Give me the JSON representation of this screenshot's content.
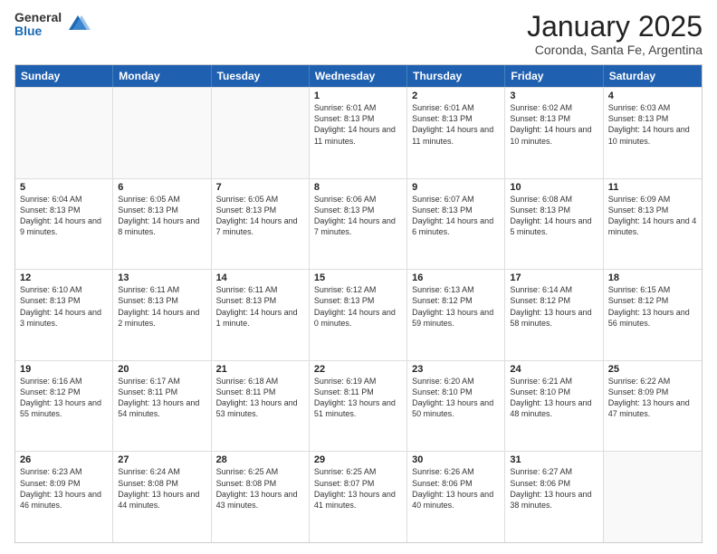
{
  "logo": {
    "general": "General",
    "blue": "Blue"
  },
  "title": "January 2025",
  "location": "Coronda, Santa Fe, Argentina",
  "days": [
    "Sunday",
    "Monday",
    "Tuesday",
    "Wednesday",
    "Thursday",
    "Friday",
    "Saturday"
  ],
  "rows": [
    [
      {
        "day": "",
        "text": ""
      },
      {
        "day": "",
        "text": ""
      },
      {
        "day": "",
        "text": ""
      },
      {
        "day": "1",
        "text": "Sunrise: 6:01 AM\nSunset: 8:13 PM\nDaylight: 14 hours and 11 minutes."
      },
      {
        "day": "2",
        "text": "Sunrise: 6:01 AM\nSunset: 8:13 PM\nDaylight: 14 hours and 11 minutes."
      },
      {
        "day": "3",
        "text": "Sunrise: 6:02 AM\nSunset: 8:13 PM\nDaylight: 14 hours and 10 minutes."
      },
      {
        "day": "4",
        "text": "Sunrise: 6:03 AM\nSunset: 8:13 PM\nDaylight: 14 hours and 10 minutes."
      }
    ],
    [
      {
        "day": "5",
        "text": "Sunrise: 6:04 AM\nSunset: 8:13 PM\nDaylight: 14 hours and 9 minutes."
      },
      {
        "day": "6",
        "text": "Sunrise: 6:05 AM\nSunset: 8:13 PM\nDaylight: 14 hours and 8 minutes."
      },
      {
        "day": "7",
        "text": "Sunrise: 6:05 AM\nSunset: 8:13 PM\nDaylight: 14 hours and 7 minutes."
      },
      {
        "day": "8",
        "text": "Sunrise: 6:06 AM\nSunset: 8:13 PM\nDaylight: 14 hours and 7 minutes."
      },
      {
        "day": "9",
        "text": "Sunrise: 6:07 AM\nSunset: 8:13 PM\nDaylight: 14 hours and 6 minutes."
      },
      {
        "day": "10",
        "text": "Sunrise: 6:08 AM\nSunset: 8:13 PM\nDaylight: 14 hours and 5 minutes."
      },
      {
        "day": "11",
        "text": "Sunrise: 6:09 AM\nSunset: 8:13 PM\nDaylight: 14 hours and 4 minutes."
      }
    ],
    [
      {
        "day": "12",
        "text": "Sunrise: 6:10 AM\nSunset: 8:13 PM\nDaylight: 14 hours and 3 minutes."
      },
      {
        "day": "13",
        "text": "Sunrise: 6:11 AM\nSunset: 8:13 PM\nDaylight: 14 hours and 2 minutes."
      },
      {
        "day": "14",
        "text": "Sunrise: 6:11 AM\nSunset: 8:13 PM\nDaylight: 14 hours and 1 minute."
      },
      {
        "day": "15",
        "text": "Sunrise: 6:12 AM\nSunset: 8:13 PM\nDaylight: 14 hours and 0 minutes."
      },
      {
        "day": "16",
        "text": "Sunrise: 6:13 AM\nSunset: 8:12 PM\nDaylight: 13 hours and 59 minutes."
      },
      {
        "day": "17",
        "text": "Sunrise: 6:14 AM\nSunset: 8:12 PM\nDaylight: 13 hours and 58 minutes."
      },
      {
        "day": "18",
        "text": "Sunrise: 6:15 AM\nSunset: 8:12 PM\nDaylight: 13 hours and 56 minutes."
      }
    ],
    [
      {
        "day": "19",
        "text": "Sunrise: 6:16 AM\nSunset: 8:12 PM\nDaylight: 13 hours and 55 minutes."
      },
      {
        "day": "20",
        "text": "Sunrise: 6:17 AM\nSunset: 8:11 PM\nDaylight: 13 hours and 54 minutes."
      },
      {
        "day": "21",
        "text": "Sunrise: 6:18 AM\nSunset: 8:11 PM\nDaylight: 13 hours and 53 minutes."
      },
      {
        "day": "22",
        "text": "Sunrise: 6:19 AM\nSunset: 8:11 PM\nDaylight: 13 hours and 51 minutes."
      },
      {
        "day": "23",
        "text": "Sunrise: 6:20 AM\nSunset: 8:10 PM\nDaylight: 13 hours and 50 minutes."
      },
      {
        "day": "24",
        "text": "Sunrise: 6:21 AM\nSunset: 8:10 PM\nDaylight: 13 hours and 48 minutes."
      },
      {
        "day": "25",
        "text": "Sunrise: 6:22 AM\nSunset: 8:09 PM\nDaylight: 13 hours and 47 minutes."
      }
    ],
    [
      {
        "day": "26",
        "text": "Sunrise: 6:23 AM\nSunset: 8:09 PM\nDaylight: 13 hours and 46 minutes."
      },
      {
        "day": "27",
        "text": "Sunrise: 6:24 AM\nSunset: 8:08 PM\nDaylight: 13 hours and 44 minutes."
      },
      {
        "day": "28",
        "text": "Sunrise: 6:25 AM\nSunset: 8:08 PM\nDaylight: 13 hours and 43 minutes."
      },
      {
        "day": "29",
        "text": "Sunrise: 6:25 AM\nSunset: 8:07 PM\nDaylight: 13 hours and 41 minutes."
      },
      {
        "day": "30",
        "text": "Sunrise: 6:26 AM\nSunset: 8:06 PM\nDaylight: 13 hours and 40 minutes."
      },
      {
        "day": "31",
        "text": "Sunrise: 6:27 AM\nSunset: 8:06 PM\nDaylight: 13 hours and 38 minutes."
      },
      {
        "day": "",
        "text": ""
      }
    ]
  ]
}
